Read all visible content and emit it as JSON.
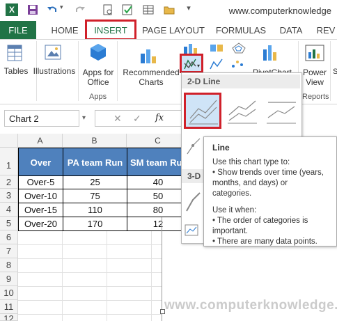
{
  "window": {
    "title_url": "www.computerknowledge"
  },
  "tabs": {
    "file": "FILE",
    "home": "HOME",
    "insert": "INSERT",
    "page_layout": "PAGE LAYOUT",
    "formulas": "FORMULAS",
    "data": "DATA",
    "review": "REV"
  },
  "ribbon": {
    "tables": "Tables",
    "illustrations": "Illustrations",
    "apps_for_office": "Apps for Office",
    "apps_group": "Apps",
    "recommended_charts": "Recommended Charts",
    "pivotchart": "PivotChart",
    "power_view": "Power View",
    "reports_group": "Reports"
  },
  "formula_bar": {
    "name_box": "Chart 2",
    "fx": "fx"
  },
  "columns": [
    "A",
    "B",
    "C"
  ],
  "rows": [
    "1",
    "2",
    "3",
    "4",
    "5",
    "6",
    "7",
    "8",
    "9",
    "10",
    "11",
    "12"
  ],
  "table": {
    "headers": [
      "Over",
      "PA team Run",
      "SM team Run"
    ],
    "data": [
      [
        "Over-5",
        "25",
        "40"
      ],
      [
        "Over-10",
        "75",
        "50"
      ],
      [
        "Over-15",
        "110",
        "80"
      ],
      [
        "Over-20",
        "170",
        "12"
      ]
    ]
  },
  "dropdown": {
    "section_2d": "2-D Line",
    "section_3d": "3-D"
  },
  "tooltip": {
    "title": "Line",
    "line1": "Use this chart type to:",
    "line2": "• Show trends over time (years, months, and days) or categories.",
    "line3": "Use it when:",
    "line4": "• The order of categories is important.",
    "line5": "• There are many data points."
  },
  "watermark": "www.computerknowledge.net",
  "colors": {
    "excel_green": "#217346",
    "highlight_red": "#d0202a",
    "header_blue": "#4f81bd"
  }
}
